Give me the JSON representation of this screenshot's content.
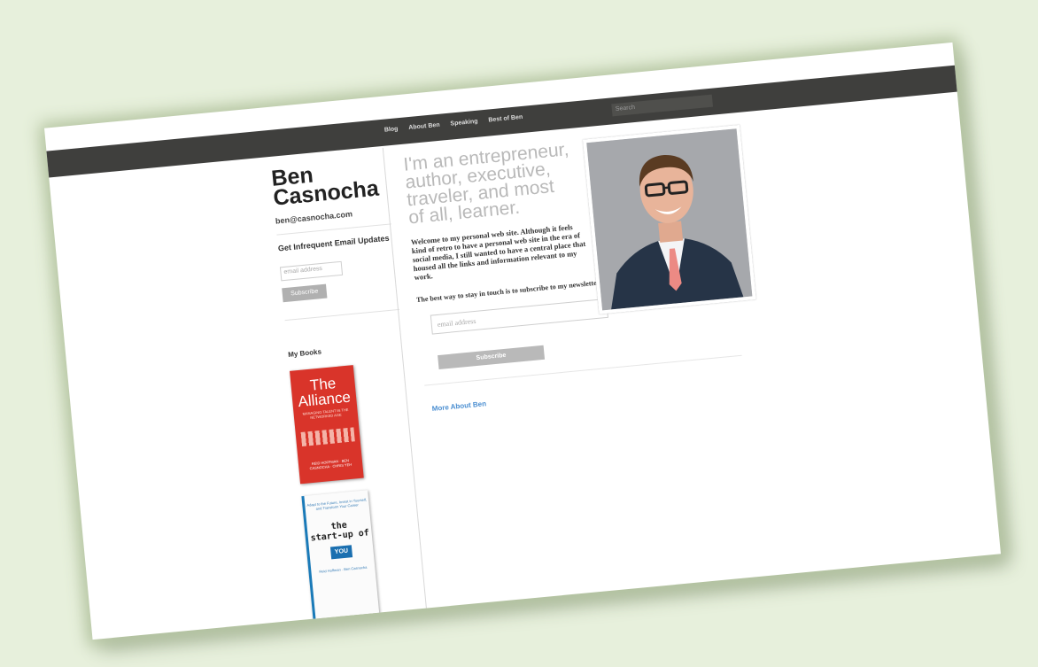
{
  "nav": {
    "items": [
      "Blog",
      "About Ben",
      "Speaking",
      "Best of Ben"
    ],
    "search_placeholder": "Search"
  },
  "sidebar": {
    "site_name_line1": "Ben",
    "site_name_line2": "Casnocha",
    "email": "ben@casnocha.com",
    "updates_heading": "Get Infrequent Email Updates",
    "email_placeholder": "email address",
    "subscribe_label": "Subscribe",
    "books_heading": "My Books",
    "book1": {
      "title_line1": "The",
      "title_line2": "Alliance",
      "subtitle": "MANAGING TALENT IN THE NETWORKED AGE",
      "authors": "REID HOFFMAN · BEN CASNOCHA · CHRIS YEH"
    },
    "book2": {
      "top_text": "Adapt to the Future, Invest in Yourself, and Transform Your Career",
      "title_line1": "the",
      "title_line2": "start-up of",
      "title_line3": "YOU",
      "authors": "Reid Hoffman · Ben Casnocha"
    }
  },
  "main": {
    "tagline": "I'm an entrepreneur, author, executive, traveler, and most of all, learner.",
    "welcome": "Welcome to my personal web site. Although it feels kind of retro to have a personal web site in the era of social media, I still wanted to have a central place that housed all the links and information relevant to my work.",
    "stay_in_touch": "The best way to stay in touch is to subscribe to my newsletter, which goes out a few times a year:",
    "email_placeholder": "email address",
    "subscribe_label": "Subscribe",
    "more_link": "More About Ben"
  },
  "colors": {
    "background": "#e7f0dc",
    "topbar": "#3f3f3d",
    "link": "#4a8ed1",
    "book_red": "#d9342a"
  }
}
